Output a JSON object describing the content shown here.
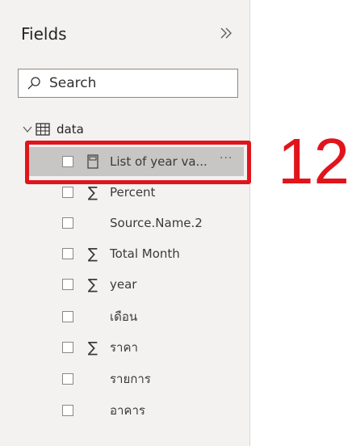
{
  "pane": {
    "title": "Fields",
    "collapse_icon": "double-chevron-right-icon"
  },
  "search": {
    "placeholder": "Search",
    "value": ""
  },
  "table": {
    "name": "data",
    "icon": "table-icon",
    "expanded": true
  },
  "fields": [
    {
      "name": "List of year va...",
      "type_icon": "calculator-icon",
      "selected": true,
      "more": "···"
    },
    {
      "name": "Percent",
      "type_icon": "sigma-icon"
    },
    {
      "name": "Source.Name.2",
      "type_icon": ""
    },
    {
      "name": "Total Month",
      "type_icon": "sigma-icon"
    },
    {
      "name": "year",
      "type_icon": "sigma-icon"
    },
    {
      "name": "เดือน",
      "type_icon": ""
    },
    {
      "name": "ราคา",
      "type_icon": "sigma-icon"
    },
    {
      "name": "รายการ",
      "type_icon": ""
    },
    {
      "name": "อาคาร",
      "type_icon": ""
    }
  ],
  "annotation": {
    "label": "12",
    "color": "#e0151c"
  }
}
